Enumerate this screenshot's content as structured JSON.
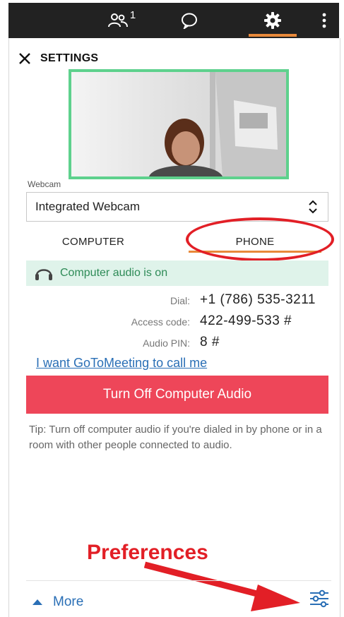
{
  "topbar": {
    "people_count": "1",
    "icons": [
      "people-icon",
      "chat-icon",
      "gear-icon",
      "more-vert-icon"
    ]
  },
  "header": {
    "title": "SETTINGS",
    "close_icon": "close-icon"
  },
  "webcam": {
    "label": "Webcam",
    "selected": "Integrated Webcam",
    "select_icon": "chevron-updown-icon"
  },
  "audio_tabs": {
    "computer": "COMPUTER",
    "phone": "PHONE",
    "active": "phone"
  },
  "status": {
    "text": "Computer audio is on",
    "icon": "headset-icon",
    "bg": "#dff3ea"
  },
  "dial_info": {
    "dial_label": "Dial:",
    "dial_value": "+1 (786) 535-3211",
    "access_label": "Access code:",
    "access_value": "422-499-533 #",
    "pin_label": "Audio PIN:",
    "pin_value": "8 #"
  },
  "call_link": "I want GoToMeeting to call me",
  "primary_button": {
    "label": "Turn Off Computer Audio",
    "color": "#ee4659"
  },
  "tip": "Tip: Turn off computer audio if you're dialed in by phone or in a room with other people connected to audio.",
  "annotation": {
    "label": "Preferences",
    "color": "#e21f26"
  },
  "footer": {
    "more_label": "More",
    "more_icon": "caret-up-icon",
    "prefs_icon": "sliders-icon"
  },
  "colors": {
    "accent": "#e8893a",
    "link": "#2a6fb6",
    "topbar": "#222222"
  }
}
